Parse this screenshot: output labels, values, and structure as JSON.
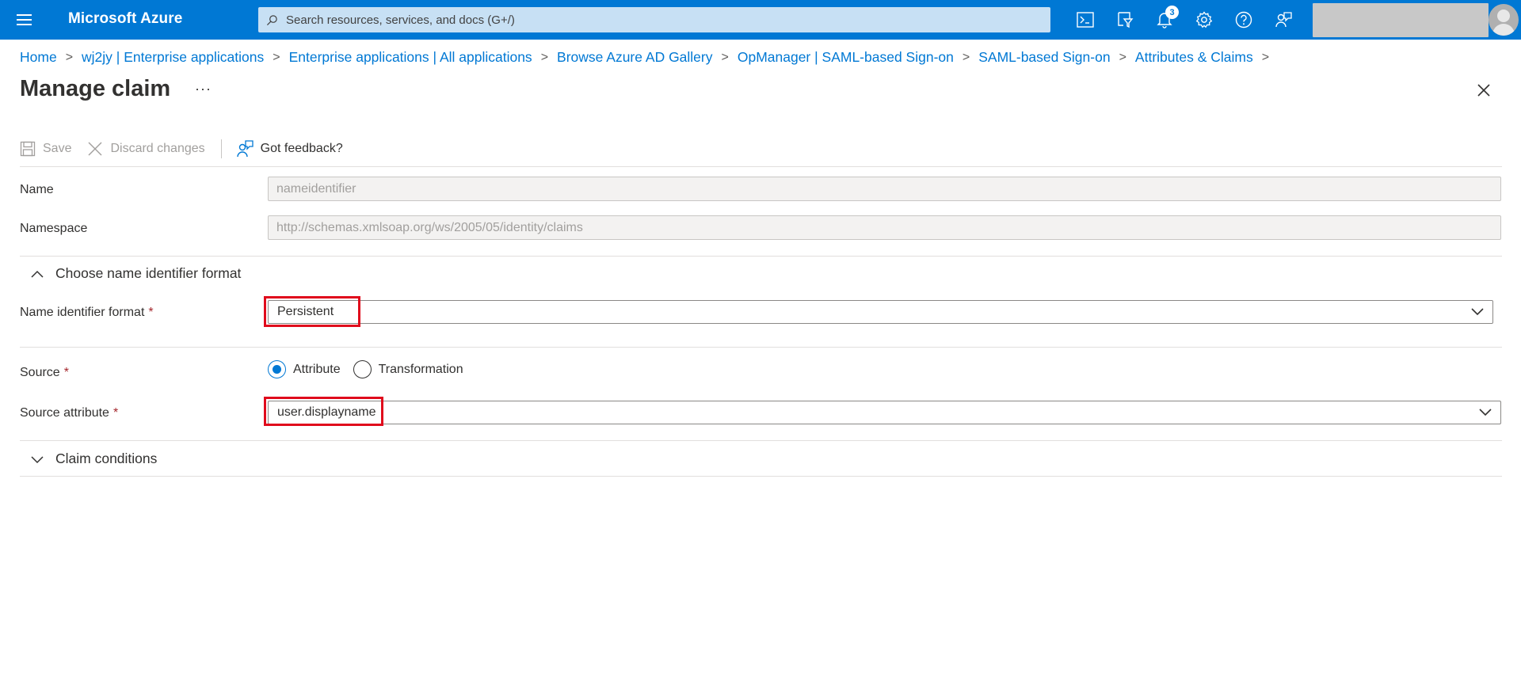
{
  "topbar": {
    "brand": "Microsoft Azure",
    "search_placeholder": "Search resources, services, and docs (G+/)",
    "notification_count": "3",
    "icons": [
      "menu-icon",
      "cloud-shell-icon",
      "directory-filter-icon",
      "notifications-icon",
      "settings-icon",
      "help-icon",
      "feedback-icon"
    ],
    "accent": "#0078d4"
  },
  "breadcrumb": [
    {
      "label": "Home"
    },
    {
      "label": "wj2jy | Enterprise applications"
    },
    {
      "label": "Enterprise applications | All applications"
    },
    {
      "label": "Browse Azure AD Gallery"
    },
    {
      "label": "OpManager | SAML-based Sign-on"
    },
    {
      "label": "SAML-based Sign-on"
    },
    {
      "label": "Attributes & Claims"
    }
  ],
  "page": {
    "title": "Manage claim",
    "more": "···"
  },
  "commands": {
    "save": "Save",
    "discard": "Discard changes",
    "feedback": "Got feedback?"
  },
  "form": {
    "name_label": "Name",
    "name_value": "nameidentifier",
    "namespace_label": "Namespace",
    "namespace_value": "http://schemas.xmlsoap.org/ws/2005/05/identity/claims",
    "name_id_section": "Choose name identifier format",
    "name_id_format_label": "Name identifier format",
    "name_id_format_value": "Persistent",
    "source_label": "Source",
    "source_options": [
      "Attribute",
      "Transformation"
    ],
    "source_selected": "Attribute",
    "source_attribute_label": "Source attribute",
    "source_attribute_value": "user.displayname",
    "claim_conditions": "Claim conditions",
    "required_marker": "*"
  },
  "colors": {
    "required": "#a4262c",
    "highlight_box": "#e00b1c",
    "link": "#0078d4"
  }
}
